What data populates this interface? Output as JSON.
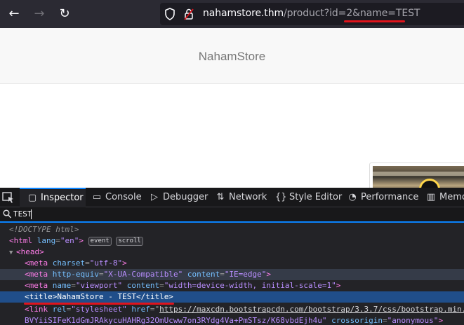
{
  "browser": {
    "url_host": "nahamstore.thm",
    "url_path": "/product?id=2",
    "url_query": "&name=TEST",
    "nav": {
      "back": "←",
      "forward": "→",
      "reload": "↻"
    }
  },
  "page": {
    "brand": "NahamStore"
  },
  "devtools": {
    "tabs": [
      {
        "label": "Inspector",
        "icon": "inspector-icon"
      },
      {
        "label": "Console",
        "icon": "console-icon"
      },
      {
        "label": "Debugger",
        "icon": "debugger-icon"
      },
      {
        "label": "Network",
        "icon": "network-icon"
      },
      {
        "label": "Style Editor",
        "icon": "style-editor-icon"
      },
      {
        "label": "Performance",
        "icon": "performance-icon"
      },
      {
        "label": "Memo",
        "icon": "memory-icon"
      }
    ],
    "search_value": "TEST",
    "markup": {
      "doctype": "<!DOCTYPE html>",
      "html_open": "<html",
      "html_lang_attr": "lang",
      "html_lang_val": "\"en\"",
      "html_close": ">",
      "badge_event": "event",
      "badge_scroll": "scroll",
      "head_open": "<head>",
      "meta1": {
        "tag": "<meta",
        "attr": "charset",
        "val": "\"utf-8\"",
        "end": ">"
      },
      "meta2": {
        "tag": "<meta",
        "attr1": "http-equiv",
        "val1": "\"X-UA-Compatible\"",
        "attr2": "content",
        "val2": "\"IE=edge\"",
        "end": ">"
      },
      "meta3": {
        "tag": "<meta",
        "attr1": "name",
        "val1": "\"viewport\"",
        "attr2": "content",
        "val2": "\"width=device-width, initial-scale=1\"",
        "end": ">"
      },
      "title": {
        "open": "<title>",
        "text": "NahamStore - TEST",
        "close": "</title>"
      },
      "link": {
        "tag": "<link",
        "attr1": "rel",
        "val1": "\"stylesheet\"",
        "attr2": "href",
        "val2": "https://maxcdn.bootstrapcdn.com/bootstrap/3.3.7/css/bootstrap.min.",
        "cont": "BVYiiSIFeK1dGmJRAkycuHAHRg32OmUcww7on3RYdg4Va+PmSTsz/K68vbdEjh4u\"",
        "attr3": "crossorigin",
        "val3": "\"anonymous\"",
        "end": ">"
      }
    }
  }
}
